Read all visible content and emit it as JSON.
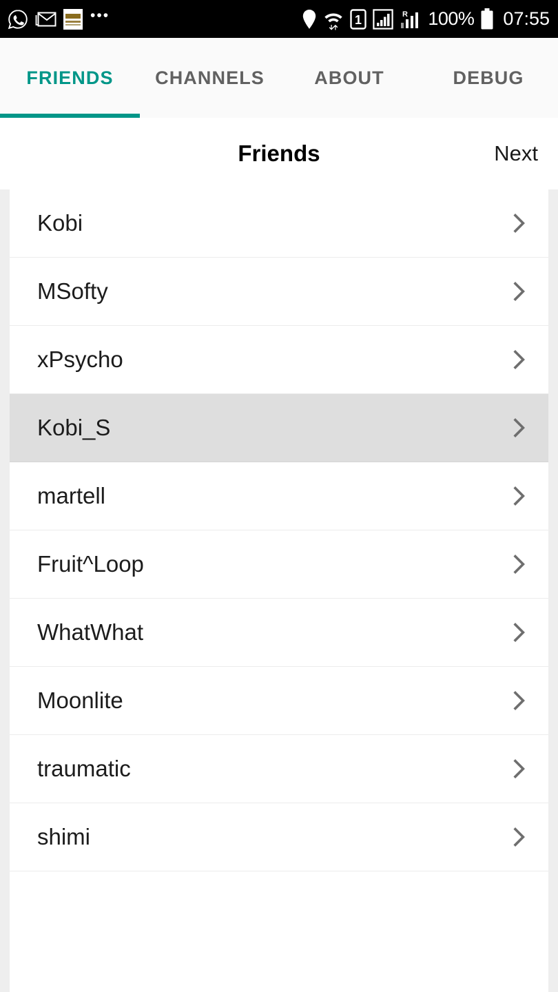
{
  "status_bar": {
    "notification_icons": [
      "whatsapp-icon",
      "gmail-icon",
      "news-app-icon"
    ],
    "notification_overflow": "•••",
    "right_icons": [
      "location-icon",
      "wifi-icon",
      "sim-1-icon",
      "signal-icon",
      "roaming-signal-icon"
    ],
    "battery_percent": "100%",
    "time": "07:55"
  },
  "tabs": {
    "items": [
      {
        "label": "FRIENDS",
        "active": true
      },
      {
        "label": "CHANNELS",
        "active": false
      },
      {
        "label": "ABOUT",
        "active": false
      },
      {
        "label": "DEBUG",
        "active": false
      }
    ],
    "accent_color": "#009688"
  },
  "header": {
    "title": "Friends",
    "next_label": "Next"
  },
  "friends": {
    "selected_index": 3,
    "highlight_color": "#dedede",
    "items": [
      {
        "name": "Kobi"
      },
      {
        "name": "MSofty"
      },
      {
        "name": "xPsycho"
      },
      {
        "name": "Kobi_S"
      },
      {
        "name": "martell"
      },
      {
        "name": "Fruit^Loop"
      },
      {
        "name": "WhatWhat"
      },
      {
        "name": "Moonlite"
      },
      {
        "name": "traumatic"
      },
      {
        "name": "shimi"
      }
    ]
  }
}
